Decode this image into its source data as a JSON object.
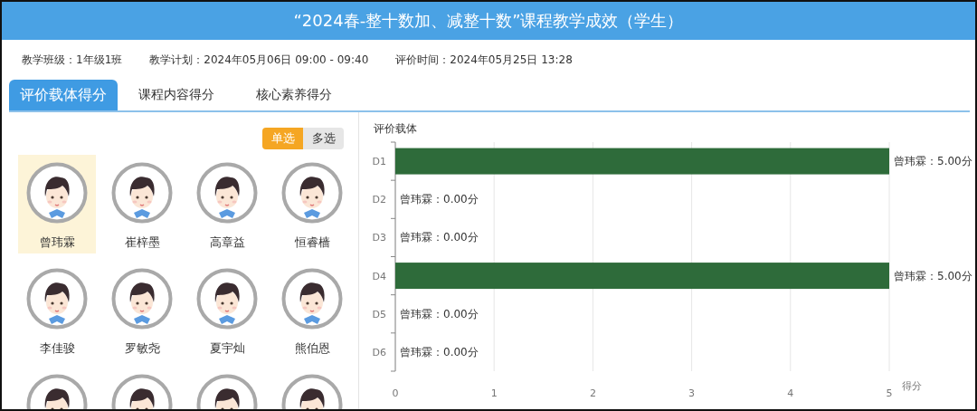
{
  "window": {
    "title": "“2024春-整十数加、减整十数”课程教学成效（学生）"
  },
  "info": [
    "教学班级：1年级1班",
    "教学计划：2024年05月06日 09:00 - 09:40",
    "评价时间：2024年05月25日 13:28"
  ],
  "tabs": [
    {
      "label": "评价载体得分",
      "selected": true
    },
    {
      "label": "课程内容得分",
      "selected": false
    },
    {
      "label": "核心素养得分",
      "selected": false
    }
  ],
  "mode_toggle": [
    {
      "label": "单选",
      "selected": true
    },
    {
      "label": "多选",
      "selected": false
    }
  ],
  "students": [
    {
      "name": "曾玮霖",
      "selected": true
    },
    {
      "name": "崔梓墨",
      "selected": false
    },
    {
      "name": "高章益",
      "selected": false
    },
    {
      "name": "恒睿樯",
      "selected": false
    },
    {
      "name": "李佳骏",
      "selected": false
    },
    {
      "name": "罗敏尧",
      "selected": false
    },
    {
      "name": "夏宇灿",
      "selected": false
    },
    {
      "name": "熊伯恩",
      "selected": false
    },
    {
      "selected": false
    },
    {
      "selected": false
    },
    {
      "selected": false
    },
    {
      "selected": false
    }
  ],
  "chart_data": {
    "type": "bar",
    "orientation": "horizontal",
    "title": "评价载体",
    "xlabel": "得分",
    "categories": [
      "D1",
      "D2",
      "D3",
      "D4",
      "D5",
      "D6"
    ],
    "grid": true,
    "series": [
      {
        "color": "#2e6b3a",
        "values": [
          5,
          0,
          0,
          5,
          0,
          0
        ]
      }
    ],
    "xlim": [
      0,
      5
    ],
    "xticks": [
      0,
      1,
      2,
      3,
      4,
      5
    ],
    "value_labels": [
      "曾玮霖：5.00分",
      "曾玮霖：0.00分",
      "曾玮霖：0.00分",
      "曾玮霖：5.00分",
      "曾玮霖：0.00分",
      "曾玮霖：0.00分"
    ]
  }
}
